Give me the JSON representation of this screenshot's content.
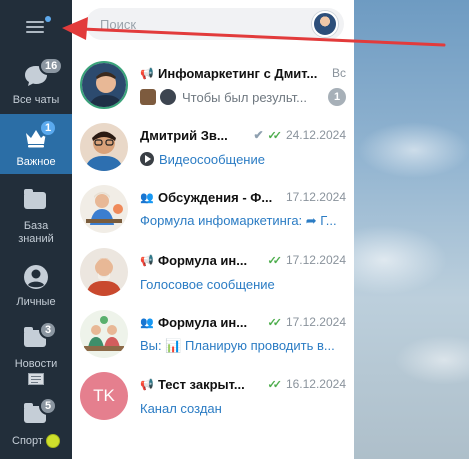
{
  "sidebar": {
    "folders": [
      {
        "label": "Все чаты",
        "badge": "16",
        "icon": "chat-bubble-icon"
      },
      {
        "label": "Важное",
        "badge": "1",
        "icon": "crown-icon"
      },
      {
        "label": "База знаний",
        "badge": "",
        "icon": "folder-icon"
      },
      {
        "label": "Личные",
        "badge": "",
        "icon": "user-icon"
      },
      {
        "label": "Новости",
        "badge": "3",
        "icon": "newspaper-icon"
      },
      {
        "label": "Спорт",
        "badge": "5",
        "icon": "tennis-ball-icon"
      }
    ]
  },
  "search": {
    "placeholder": "Поиск"
  },
  "chats": [
    {
      "title": "Инфомаркетинг с Дмит...",
      "date": "Вс",
      "subtitle": "Чтобы был результ...",
      "unread": "1",
      "type_icon": "megaphone-icon"
    },
    {
      "title": "Дмитрий Зв...",
      "date": "24.12.2024",
      "subtitle": "Видеосообщение",
      "type_icon": ""
    },
    {
      "title": "Обсуждения - Ф...",
      "date": "17.12.2024",
      "subtitle": "Формула инфомаркетинга: ➦ Г...",
      "type_icon": "group-icon"
    },
    {
      "title": "Формула ин...",
      "date": "17.12.2024",
      "subtitle": "Голосовое сообщение",
      "type_icon": "megaphone-icon"
    },
    {
      "title": "Формула ин...",
      "date": "17.12.2024",
      "subtitle": "Вы: 📊 Планирую проводить в...",
      "type_icon": "group-icon"
    },
    {
      "title": "Тест закрыт...",
      "date": "16.12.2024",
      "subtitle": "Канал создан",
      "avatar_initials": "TK",
      "type_icon": "megaphone-icon"
    }
  ],
  "colors": {
    "sidebar_bg": "#222e3a",
    "active_folder": "#2b6ea6",
    "link_blue": "#2b7cc4",
    "read_ticks": "#4fae4e",
    "annotation_arrow": "#e23b3b",
    "tk_avatar": "#e57f8e"
  }
}
